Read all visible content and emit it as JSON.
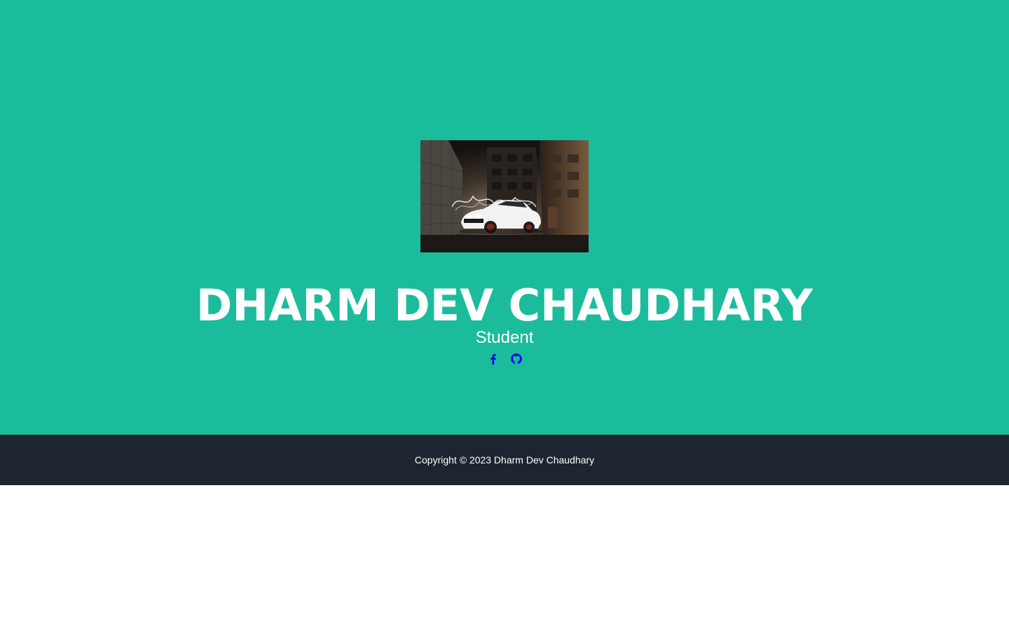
{
  "profile": {
    "name": "DHARM DEV CHAUDHARY",
    "role": "Student",
    "photo_icon": "car-photo"
  },
  "socials": [
    {
      "icon": "facebook-icon"
    },
    {
      "icon": "github-icon"
    }
  ],
  "footer": {
    "copyright": "Copyright © 2023 Dharm Dev Chaudhary"
  },
  "colors": {
    "hero_background": "#1bbc9b",
    "footer_background": "#1e2530",
    "text": "#ffffff",
    "social_icons": "#0000ee"
  }
}
